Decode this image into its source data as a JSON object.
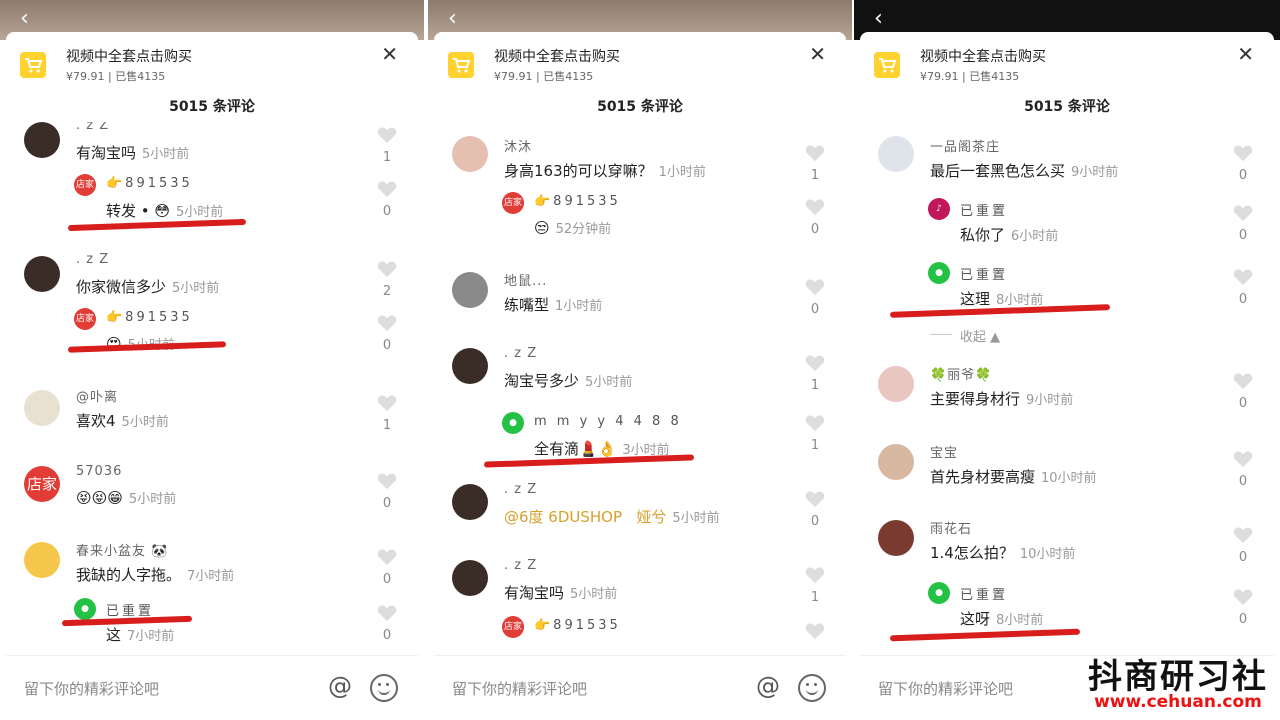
{
  "product": {
    "title": "视频中全套点击购买",
    "price": "¥79.91",
    "sold": "已售4135",
    "close_icon": "close-icon"
  },
  "comment_count": "5015 条评论",
  "input": {
    "placeholder": "留下你的精彩评论吧"
  },
  "panels": [
    {
      "comments": [
        {
          "name": ". z Z",
          "text": "有淘宝吗",
          "time": "5小时前",
          "likes": "1"
        },
        {
          "reply_name": "👉891535",
          "reply_text": "转发 • 😳",
          "reply_time": "5小时前",
          "reply_likes": "0"
        },
        {
          "name": ". z Z",
          "text": "你家微信多少",
          "time": "5小时前",
          "likes": "2"
        },
        {
          "reply_name": "👉891535",
          "reply_text": "😍",
          "reply_time": "5小时前",
          "reply_likes": "0"
        },
        {
          "name": "@卟离",
          "text": "喜欢4",
          "time": "5小时前",
          "likes": "1"
        },
        {
          "name": "57036",
          "text": "😝😝😁",
          "time": "5小时前",
          "likes": "0"
        },
        {
          "name": "春来小盆友 🐼",
          "text": "我缺的人字拖。",
          "time": "7小时前",
          "likes": "0"
        },
        {
          "reply_name": "已重置",
          "reply_text": "这",
          "reply_time": "7小时前",
          "reply_likes": "0"
        }
      ]
    },
    {
      "comments": [
        {
          "name": "沐沐",
          "text": "身高163的可以穿嘛？",
          "time": "1小时前",
          "likes": "1"
        },
        {
          "reply_name": "👉891535",
          "reply_text": "😒",
          "reply_time": "52分钟前",
          "reply_likes": "0"
        },
        {
          "name": "地鼠...",
          "text": "练嘴型",
          "time": "1小时前",
          "likes": "0"
        },
        {
          "name": ". z Z",
          "text": "淘宝号多少",
          "time": "5小时前",
          "likes": "1"
        },
        {
          "reply_name": "m m y y 4 4 8 8",
          "reply_text": "全有滴💄👌",
          "reply_time": "3小时前",
          "reply_likes": "1"
        },
        {
          "name": ". z Z",
          "text_tag": "@6度 6DUSHOP",
          "text_tag2": "娅兮",
          "time": "5小时前",
          "likes": "0"
        },
        {
          "name": ". z Z",
          "text": "有淘宝吗",
          "time": "5小时前",
          "likes": "1"
        },
        {
          "reply_name": "👉891535"
        }
      ]
    },
    {
      "comments": [
        {
          "name": "一品阁茶庄",
          "text": "最后一套黑色怎么买",
          "time": "9小时前",
          "likes": "0"
        },
        {
          "reply_name": "已重置",
          "reply_text": "私你了",
          "reply_time": "6小时前",
          "reply_likes": "0"
        },
        {
          "reply_name": "已重置",
          "reply_text": "这理",
          "reply_time": "8小时前",
          "reply_likes": "0"
        },
        {
          "collapse": "收起 ▲"
        },
        {
          "name": "🍀丽爷🍀",
          "text": "主要得身材行",
          "time": "9小时前",
          "likes": "0"
        },
        {
          "name": "宝宝",
          "text": "首先身材要高瘦",
          "time": "10小时前",
          "likes": "0"
        },
        {
          "name": "雨花石",
          "text": "1.4怎么拍？",
          "time": "10小时前",
          "likes": "0"
        },
        {
          "reply_name": "已重置",
          "reply_text": "这呀",
          "reply_time": "8小时前",
          "reply_likes": "0"
        }
      ]
    }
  ],
  "watermark": {
    "title": "抖商研习社",
    "url": "www.cehuan.com"
  },
  "colors": {
    "accent": "#ffd22f",
    "stroke": "#d81d1d",
    "shop_badge": "#e23c37",
    "wechat": "#23c144"
  }
}
